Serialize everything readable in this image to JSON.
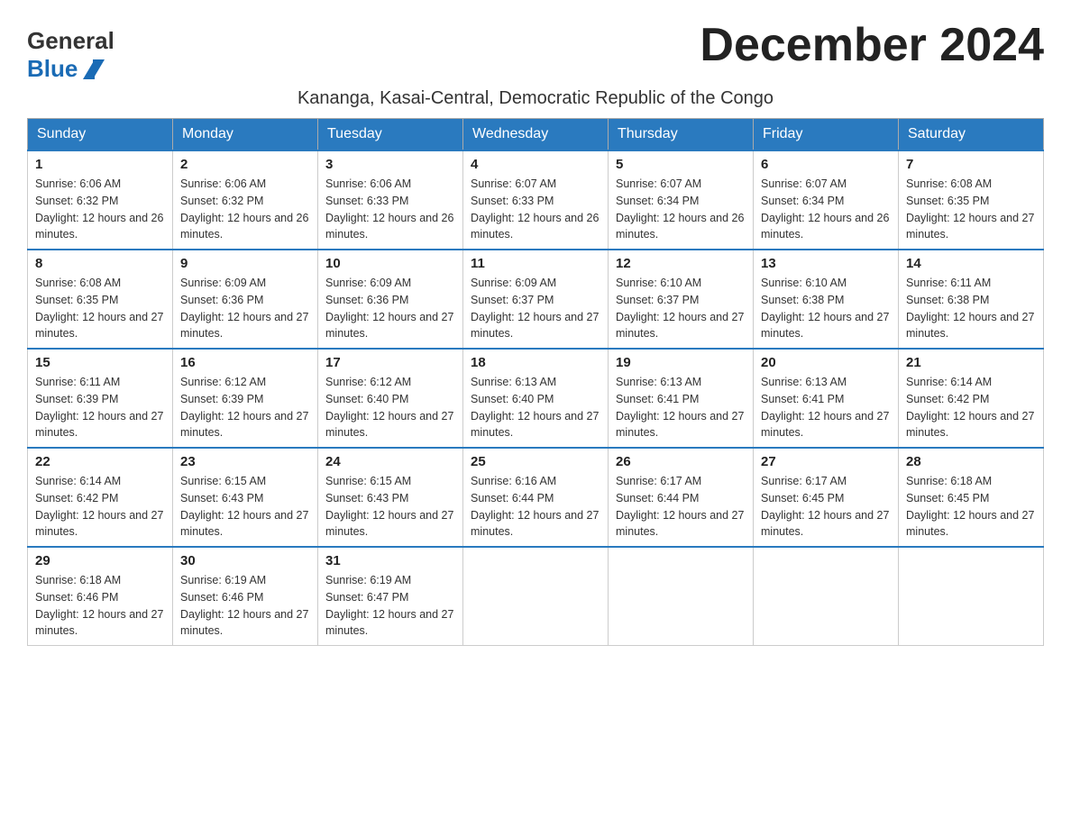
{
  "header": {
    "logo_general": "General",
    "logo_blue": "Blue",
    "month_title": "December 2024",
    "subtitle": "Kananga, Kasai-Central, Democratic Republic of the Congo"
  },
  "weekdays": [
    "Sunday",
    "Monday",
    "Tuesday",
    "Wednesday",
    "Thursday",
    "Friday",
    "Saturday"
  ],
  "weeks": [
    [
      {
        "day": "1",
        "sunrise": "6:06 AM",
        "sunset": "6:32 PM",
        "daylight": "12 hours and 26 minutes."
      },
      {
        "day": "2",
        "sunrise": "6:06 AM",
        "sunset": "6:32 PM",
        "daylight": "12 hours and 26 minutes."
      },
      {
        "day": "3",
        "sunrise": "6:06 AM",
        "sunset": "6:33 PM",
        "daylight": "12 hours and 26 minutes."
      },
      {
        "day": "4",
        "sunrise": "6:07 AM",
        "sunset": "6:33 PM",
        "daylight": "12 hours and 26 minutes."
      },
      {
        "day": "5",
        "sunrise": "6:07 AM",
        "sunset": "6:34 PM",
        "daylight": "12 hours and 26 minutes."
      },
      {
        "day": "6",
        "sunrise": "6:07 AM",
        "sunset": "6:34 PM",
        "daylight": "12 hours and 26 minutes."
      },
      {
        "day": "7",
        "sunrise": "6:08 AM",
        "sunset": "6:35 PM",
        "daylight": "12 hours and 27 minutes."
      }
    ],
    [
      {
        "day": "8",
        "sunrise": "6:08 AM",
        "sunset": "6:35 PM",
        "daylight": "12 hours and 27 minutes."
      },
      {
        "day": "9",
        "sunrise": "6:09 AM",
        "sunset": "6:36 PM",
        "daylight": "12 hours and 27 minutes."
      },
      {
        "day": "10",
        "sunrise": "6:09 AM",
        "sunset": "6:36 PM",
        "daylight": "12 hours and 27 minutes."
      },
      {
        "day": "11",
        "sunrise": "6:09 AM",
        "sunset": "6:37 PM",
        "daylight": "12 hours and 27 minutes."
      },
      {
        "day": "12",
        "sunrise": "6:10 AM",
        "sunset": "6:37 PM",
        "daylight": "12 hours and 27 minutes."
      },
      {
        "day": "13",
        "sunrise": "6:10 AM",
        "sunset": "6:38 PM",
        "daylight": "12 hours and 27 minutes."
      },
      {
        "day": "14",
        "sunrise": "6:11 AM",
        "sunset": "6:38 PM",
        "daylight": "12 hours and 27 minutes."
      }
    ],
    [
      {
        "day": "15",
        "sunrise": "6:11 AM",
        "sunset": "6:39 PM",
        "daylight": "12 hours and 27 minutes."
      },
      {
        "day": "16",
        "sunrise": "6:12 AM",
        "sunset": "6:39 PM",
        "daylight": "12 hours and 27 minutes."
      },
      {
        "day": "17",
        "sunrise": "6:12 AM",
        "sunset": "6:40 PM",
        "daylight": "12 hours and 27 minutes."
      },
      {
        "day": "18",
        "sunrise": "6:13 AM",
        "sunset": "6:40 PM",
        "daylight": "12 hours and 27 minutes."
      },
      {
        "day": "19",
        "sunrise": "6:13 AM",
        "sunset": "6:41 PM",
        "daylight": "12 hours and 27 minutes."
      },
      {
        "day": "20",
        "sunrise": "6:13 AM",
        "sunset": "6:41 PM",
        "daylight": "12 hours and 27 minutes."
      },
      {
        "day": "21",
        "sunrise": "6:14 AM",
        "sunset": "6:42 PM",
        "daylight": "12 hours and 27 minutes."
      }
    ],
    [
      {
        "day": "22",
        "sunrise": "6:14 AM",
        "sunset": "6:42 PM",
        "daylight": "12 hours and 27 minutes."
      },
      {
        "day": "23",
        "sunrise": "6:15 AM",
        "sunset": "6:43 PM",
        "daylight": "12 hours and 27 minutes."
      },
      {
        "day": "24",
        "sunrise": "6:15 AM",
        "sunset": "6:43 PM",
        "daylight": "12 hours and 27 minutes."
      },
      {
        "day": "25",
        "sunrise": "6:16 AM",
        "sunset": "6:44 PM",
        "daylight": "12 hours and 27 minutes."
      },
      {
        "day": "26",
        "sunrise": "6:17 AM",
        "sunset": "6:44 PM",
        "daylight": "12 hours and 27 minutes."
      },
      {
        "day": "27",
        "sunrise": "6:17 AM",
        "sunset": "6:45 PM",
        "daylight": "12 hours and 27 minutes."
      },
      {
        "day": "28",
        "sunrise": "6:18 AM",
        "sunset": "6:45 PM",
        "daylight": "12 hours and 27 minutes."
      }
    ],
    [
      {
        "day": "29",
        "sunrise": "6:18 AM",
        "sunset": "6:46 PM",
        "daylight": "12 hours and 27 minutes."
      },
      {
        "day": "30",
        "sunrise": "6:19 AM",
        "sunset": "6:46 PM",
        "daylight": "12 hours and 27 minutes."
      },
      {
        "day": "31",
        "sunrise": "6:19 AM",
        "sunset": "6:47 PM",
        "daylight": "12 hours and 27 minutes."
      },
      null,
      null,
      null,
      null
    ]
  ]
}
